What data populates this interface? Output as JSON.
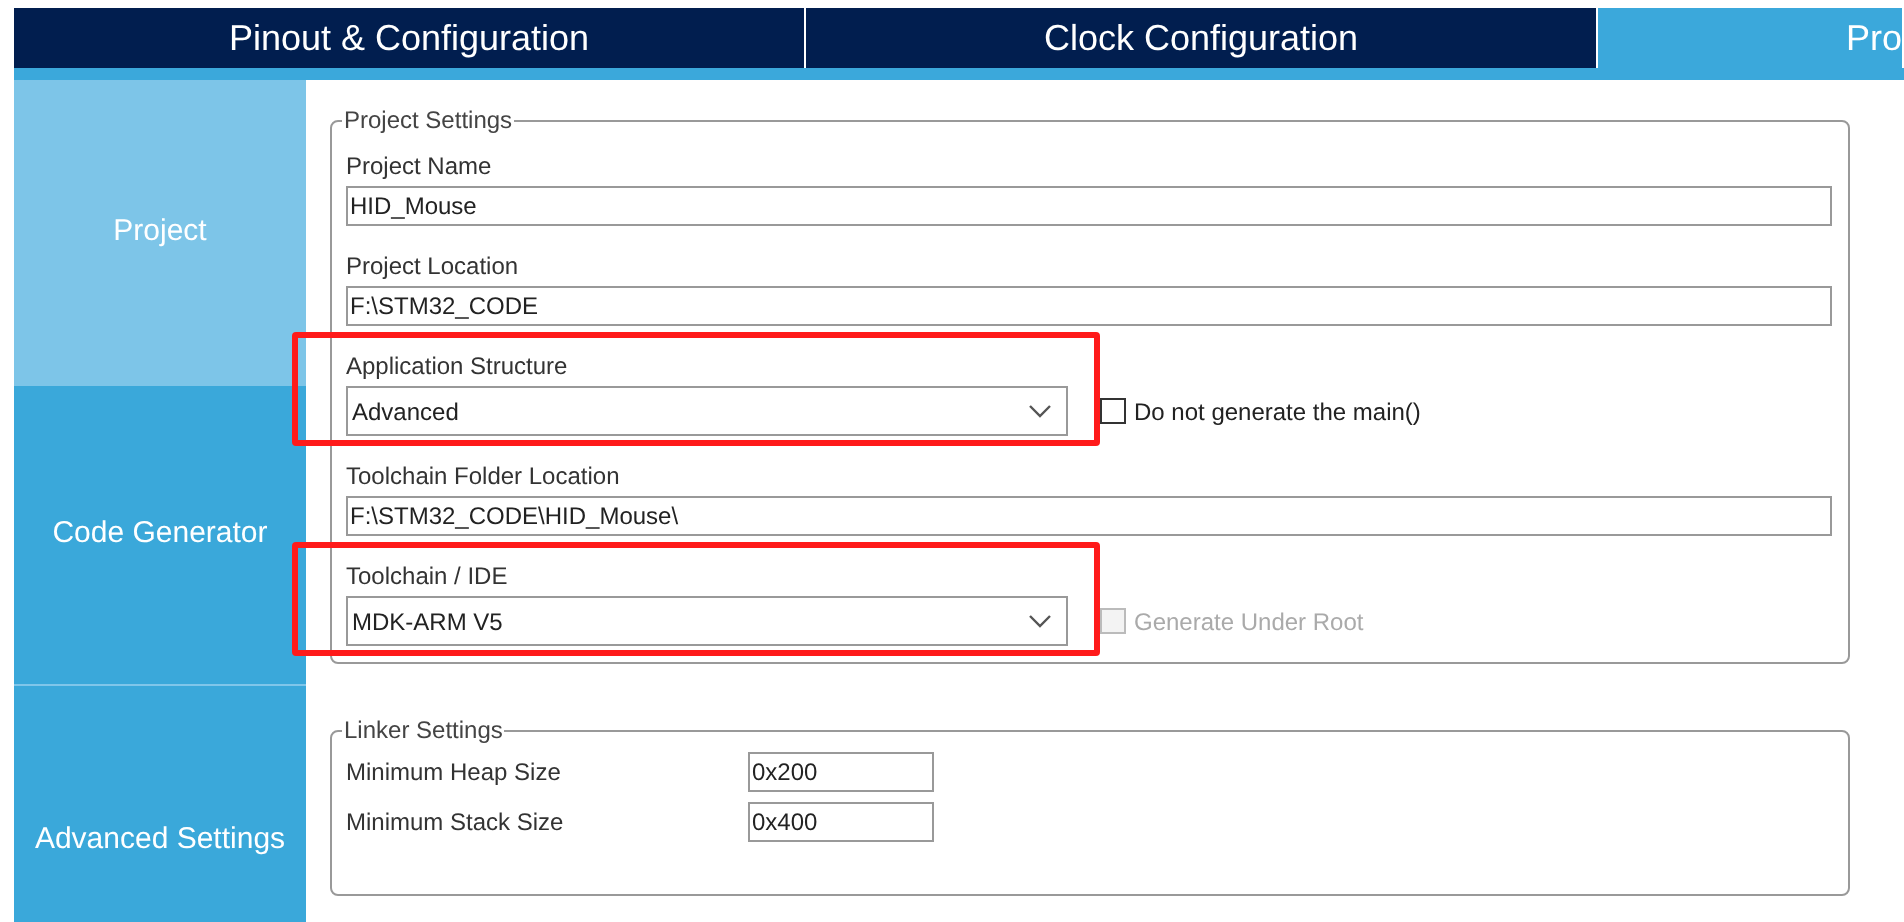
{
  "tabs": [
    {
      "label": "Pinout & Configuration",
      "selected": false
    },
    {
      "label": "Clock Configuration",
      "selected": false
    },
    {
      "label": "Pro",
      "selected": true
    }
  ],
  "sidebar": {
    "items": [
      {
        "label": "Project",
        "selected": true
      },
      {
        "label": "Code Generator",
        "selected": false
      },
      {
        "label": "Advanced Settings",
        "selected": false
      }
    ]
  },
  "project_settings": {
    "title": "Project Settings",
    "fields": [
      {
        "kind": "text",
        "label": "Project Name",
        "value": "HID_Mouse"
      },
      {
        "kind": "text",
        "label": "Project Location",
        "value": "F:\\STM32_CODE"
      },
      {
        "kind": "select",
        "label": "Application Structure",
        "value": "Advanced",
        "highlighted": true,
        "option": {
          "label": "Do not generate the main()",
          "checked": false,
          "disabled": false
        }
      },
      {
        "kind": "text",
        "label": "Toolchain Folder Location",
        "value": "F:\\STM32_CODE\\HID_Mouse\\"
      },
      {
        "kind": "select",
        "label": "Toolchain / IDE",
        "value": "MDK-ARM V5",
        "highlighted": true,
        "option": {
          "label": "Generate Under Root",
          "checked": false,
          "disabled": true
        }
      }
    ]
  },
  "linker_settings": {
    "title": "Linker Settings",
    "fields": [
      {
        "label": "Minimum Heap Size",
        "value": "0x200"
      },
      {
        "label": "Minimum Stack Size",
        "value": "0x400"
      }
    ]
  }
}
